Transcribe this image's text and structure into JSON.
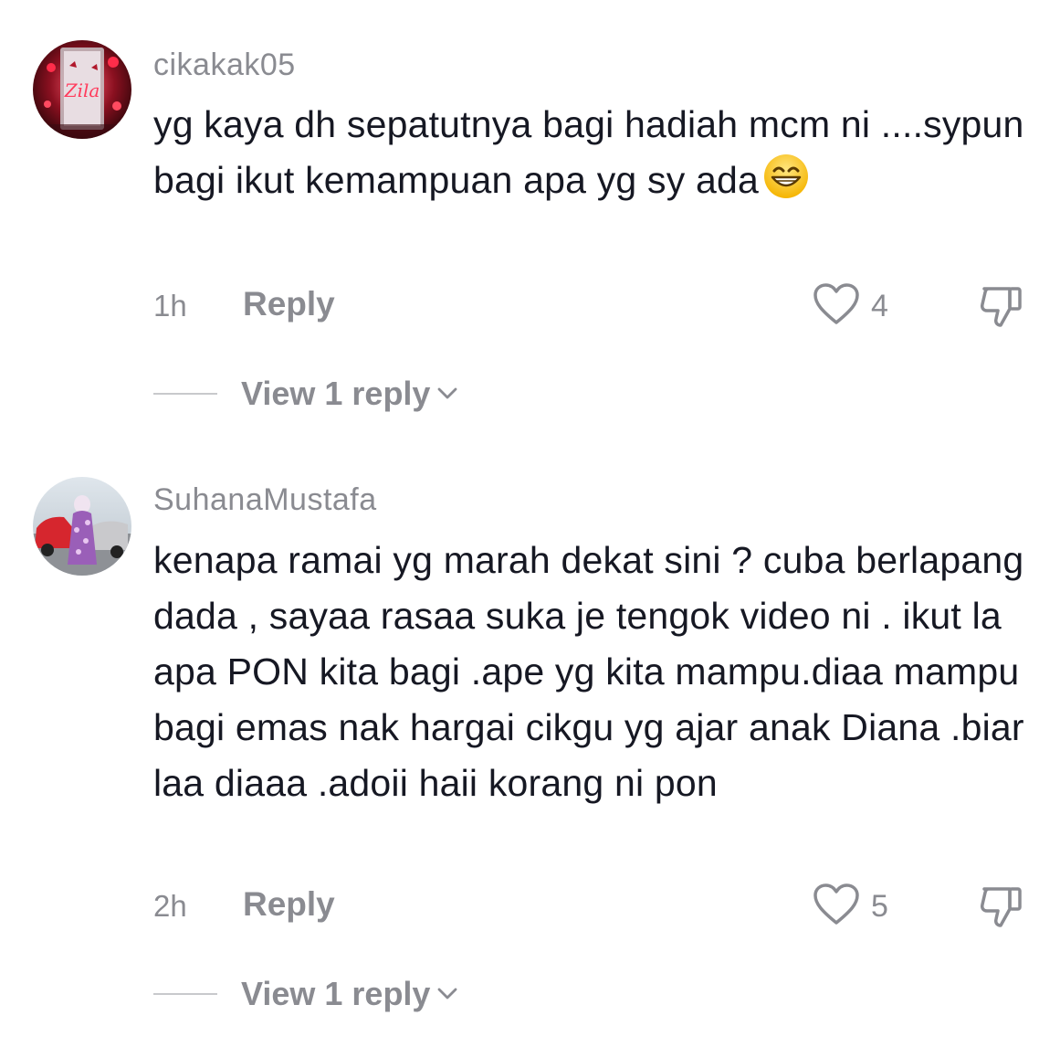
{
  "comments": [
    {
      "username": "cikakak05",
      "text": "yg kaya dh sepatutnya bagi hadiah mcm ni ....sypun bagi ikut kemampuan apa yg sy ada",
      "emoji": "grinning-face-with-smiling-eyes",
      "time": "1h",
      "reply_label": "Reply",
      "likes": "4",
      "view_replies": "View 1 reply"
    },
    {
      "username": "SuhanaMustafa",
      "text": "kenapa ramai yg marah dekat sini ? cuba berlapang dada , sayaa rasaa suka je tengok video ni . ikut la apa PON kita bagi .ape yg kita mampu.diaa mampu bagi emas nak hargai cikgu yg ajar anak Diana .biar laa diaaa .adoii haii korang ni pon",
      "time": "2h",
      "reply_label": "Reply",
      "likes": "5",
      "view_replies": "View 1 reply"
    }
  ],
  "colors": {
    "text": "#161823",
    "muted": "#8a8b91",
    "background": "#ffffff"
  },
  "avatar_0_lettering": "Zila",
  "icons": [
    "heart-outline-icon",
    "thumbs-down-icon",
    "chevron-down-icon"
  ]
}
